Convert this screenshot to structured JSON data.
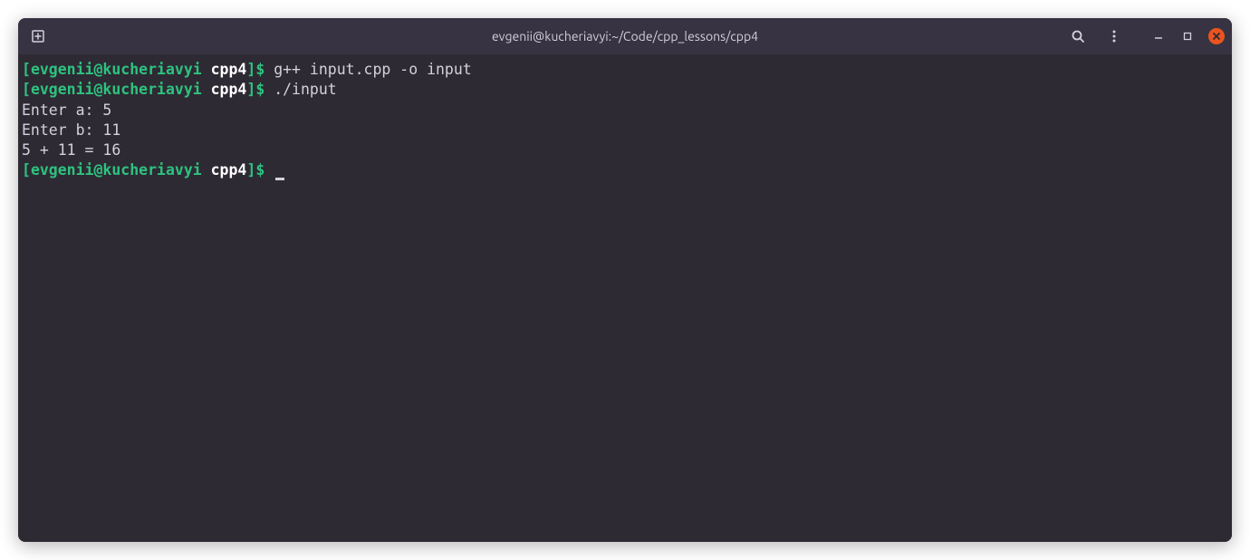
{
  "titlebar": {
    "title": "evgenii@kucheriavyi:~/Code/cpp_lessons/cpp4"
  },
  "prompt": {
    "open_bracket": "[",
    "user_host": "evgenii@kucheriavyi",
    "dir": "cpp4",
    "close_bracket": "]",
    "symbol": "$"
  },
  "lines": [
    {
      "type": "prompt",
      "command": "g++ input.cpp -o input"
    },
    {
      "type": "prompt",
      "command": "./input"
    },
    {
      "type": "output",
      "text": "Enter a: 5"
    },
    {
      "type": "output",
      "text": "Enter b: 11"
    },
    {
      "type": "output",
      "text": "5 + 11 = 16"
    },
    {
      "type": "prompt",
      "command": "",
      "cursor": true
    }
  ]
}
